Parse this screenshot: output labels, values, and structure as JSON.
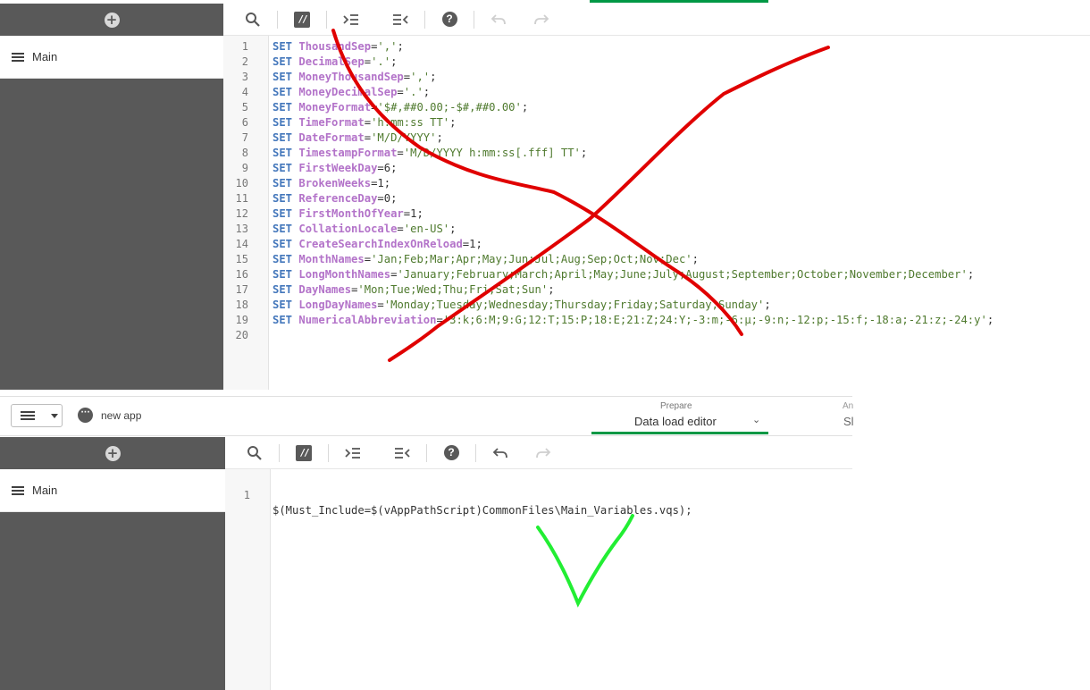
{
  "top_section": {
    "sidebar": {
      "main_label": "Main"
    },
    "script_lines": [
      {
        "n": "1",
        "key": "ThousandSep",
        "val": "','",
        "end": ";"
      },
      {
        "n": "2",
        "key": "DecimalSep",
        "val": "'.'",
        "end": ";"
      },
      {
        "n": "3",
        "key": "MoneyThousandSep",
        "val": "','",
        "end": ";"
      },
      {
        "n": "4",
        "key": "MoneyDecimalSep",
        "val": "'.'",
        "end": ";"
      },
      {
        "n": "5",
        "key": "MoneyFormat",
        "val": "'$#,##0.00;-$#,##0.00'",
        "end": ";"
      },
      {
        "n": "6",
        "key": "TimeFormat",
        "val": "'h:mm:ss TT'",
        "end": ";"
      },
      {
        "n": "7",
        "key": "DateFormat",
        "val": "'M/D/YYYY'",
        "end": ";"
      },
      {
        "n": "8",
        "key": "TimestampFormat",
        "val": "'M/D/YYYY h:mm:ss[.fff] TT'",
        "end": ";"
      },
      {
        "n": "9",
        "key": "FirstWeekDay",
        "val": "6",
        "end": ";"
      },
      {
        "n": "10",
        "key": "BrokenWeeks",
        "val": "1",
        "end": ";"
      },
      {
        "n": "11",
        "key": "ReferenceDay",
        "val": "0",
        "end": ";"
      },
      {
        "n": "12",
        "key": "FirstMonthOfYear",
        "val": "1",
        "end": ";"
      },
      {
        "n": "13",
        "key": "CollationLocale",
        "val": "'en-US'",
        "end": ";"
      },
      {
        "n": "14",
        "key": "CreateSearchIndexOnReload",
        "val": "1",
        "end": ";"
      },
      {
        "n": "15",
        "key": "MonthNames",
        "val": "'Jan;Feb;Mar;Apr;May;Jun;Jul;Aug;Sep;Oct;Nov;Dec'",
        "end": ";"
      },
      {
        "n": "16",
        "key": "LongMonthNames",
        "val": "'January;February;March;April;May;June;July;August;September;October;November;December'",
        "end": ";"
      },
      {
        "n": "17",
        "key": "DayNames",
        "val": "'Mon;Tue;Wed;Thu;Fri;Sat;Sun'",
        "end": ";"
      },
      {
        "n": "18",
        "key": "LongDayNames",
        "val": "'Monday;Tuesday;Wednesday;Thursday;Friday;Saturday;Sunday'",
        "end": ";"
      },
      {
        "n": "19",
        "key": "NumericalAbbreviation",
        "val": "'3:k;6:M;9:G;12:T;15:P;18:E;21:Z;24:Y;-3:m;-6:μ;-9:n;-12:p;-15:f;-18:a;-21:z;-24:y'",
        "end": ";"
      },
      {
        "n": "20",
        "key": "",
        "val": "",
        "end": ""
      }
    ],
    "set_keyword": "SET",
    "equals": "="
  },
  "app_bar": {
    "app_name": "new app",
    "section_small": "Prepare",
    "section_main": "Data load editor",
    "next_small": "An",
    "next_main": "Sl"
  },
  "bottom_section": {
    "sidebar": {
      "main_label": "Main"
    },
    "line_number": "1",
    "script_line": "$(Must_Include=$(vAppPathScript)CommonFiles\\Main_Variables.vqs);"
  },
  "colors": {
    "accent_green": "#009845",
    "annotation_red": "#e00000",
    "annotation_green": "#22ee33",
    "sidebar_gray": "#595959"
  }
}
